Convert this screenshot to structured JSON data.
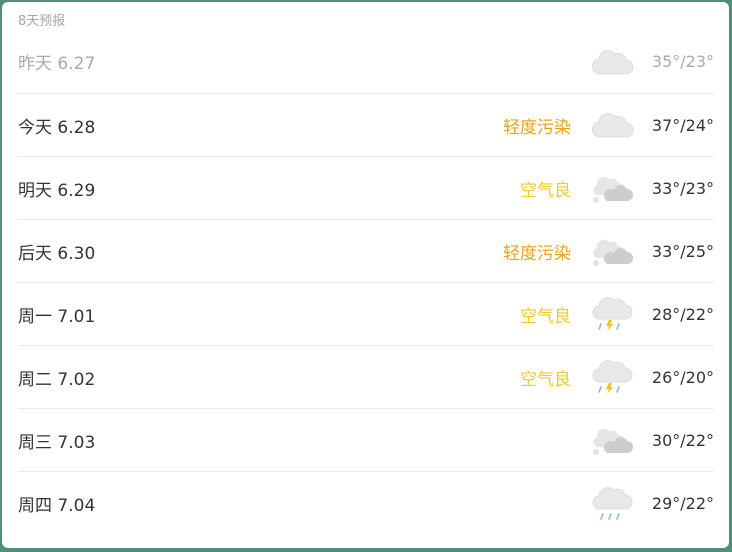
{
  "forecast": {
    "title": "8天预报",
    "colors": {
      "aq_moderate": "#e8a319",
      "aq_good": "#f2cb25",
      "text": "#333333",
      "past_text": "#aaaaaa"
    },
    "days": [
      {
        "day": "昨天 6.27",
        "air_quality": "",
        "aq_level": "",
        "weather_icon": "cloudy-icon",
        "temp": "35°/23°",
        "past": true
      },
      {
        "day": "今天 6.28",
        "air_quality": "轻度污染",
        "aq_level": "moderate",
        "weather_icon": "cloudy-icon",
        "temp": "37°/24°"
      },
      {
        "day": "明天 6.29",
        "air_quality": "空气良",
        "aq_level": "good",
        "weather_icon": "partly-cloudy-icon",
        "temp": "33°/23°"
      },
      {
        "day": "后天 6.30",
        "air_quality": "轻度污染",
        "aq_level": "moderate",
        "weather_icon": "partly-cloudy-icon",
        "temp": "33°/25°"
      },
      {
        "day": "周一 7.01",
        "air_quality": "空气良",
        "aq_level": "good",
        "weather_icon": "thunderstorm-icon",
        "temp": "28°/22°"
      },
      {
        "day": "周二 7.02",
        "air_quality": "空气良",
        "aq_level": "good",
        "weather_icon": "thunderstorm-icon",
        "temp": "26°/20°"
      },
      {
        "day": "周三 7.03",
        "air_quality": "",
        "aq_level": "",
        "weather_icon": "partly-cloudy-icon",
        "temp": "30°/22°"
      },
      {
        "day": "周四 7.04",
        "air_quality": "",
        "aq_level": "",
        "weather_icon": "light-rain-icon",
        "temp": "29°/22°"
      }
    ]
  }
}
